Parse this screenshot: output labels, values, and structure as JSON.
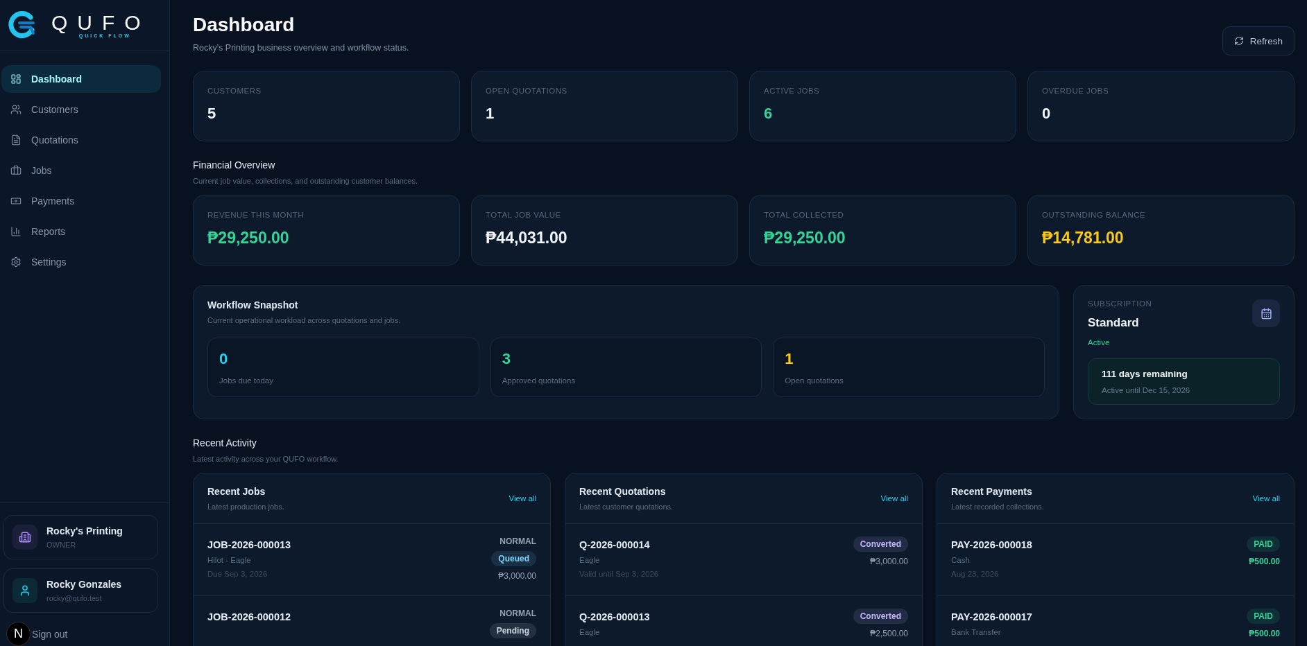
{
  "brand": {
    "name": "QUFO",
    "tagline": "QUICK FLOW"
  },
  "sidebar": {
    "items": [
      {
        "label": "Dashboard",
        "selected": true
      },
      {
        "label": "Customers",
        "selected": false
      },
      {
        "label": "Quotations",
        "selected": false
      },
      {
        "label": "Jobs",
        "selected": false
      },
      {
        "label": "Payments",
        "selected": false
      },
      {
        "label": "Reports",
        "selected": false
      },
      {
        "label": "Settings",
        "selected": false
      }
    ],
    "business": {
      "name": "Rocky's Printing",
      "role": "OWNER"
    },
    "user": {
      "name": "Rocky Gonzales",
      "email": "rocky@qufo.test"
    },
    "sign_out": "Sign out",
    "dev_indicator": "N"
  },
  "header": {
    "title": "Dashboard",
    "subtitle": "Rocky's Printing business overview and workflow status.",
    "refresh": "Refresh"
  },
  "stats": [
    {
      "label": "CUSTOMERS",
      "value": "5",
      "color": "#f1f5f9"
    },
    {
      "label": "OPEN QUOTATIONS",
      "value": "1",
      "color": "#f1f5f9"
    },
    {
      "label": "ACTIVE JOBS",
      "value": "6",
      "color": "#34d399"
    },
    {
      "label": "OVERDUE JOBS",
      "value": "0",
      "color": "#f1f5f9"
    }
  ],
  "financial": {
    "title": "Financial Overview",
    "subtitle": "Current job value, collections, and outstanding customer balances.",
    "cards": [
      {
        "label": "REVENUE THIS MONTH",
        "value": "₱29,250.00",
        "color": "#34d399"
      },
      {
        "label": "TOTAL JOB VALUE",
        "value": "₱44,031.00",
        "color": "#f1f5f9"
      },
      {
        "label": "TOTAL COLLECTED",
        "value": "₱29,250.00",
        "color": "#34d399"
      },
      {
        "label": "OUTSTANDING BALANCE",
        "value": "₱14,781.00",
        "color": "#facc15"
      }
    ]
  },
  "workflow": {
    "title": "Workflow Snapshot",
    "subtitle": "Current operational workload across quotations and jobs.",
    "items": [
      {
        "value": "0",
        "label": "Jobs due today",
        "color": "#22d3ee"
      },
      {
        "value": "3",
        "label": "Approved quotations",
        "color": "#34d399"
      },
      {
        "value": "1",
        "label": "Open quotations",
        "color": "#facc15"
      }
    ]
  },
  "subscription": {
    "label": "SUBSCRIPTION",
    "plan": "Standard",
    "status": "Active",
    "remaining": "111 days remaining",
    "until": "Active until Dec 15, 2026"
  },
  "recent": {
    "title": "Recent Activity",
    "subtitle": "Latest activity across your QUFO workflow.",
    "panels": [
      {
        "kind": "jobs",
        "title": "Recent Jobs",
        "subtitle": "Latest production jobs.",
        "link": "View all",
        "rows": [
          {
            "number": "JOB-2026-000013",
            "details": [
              "Hilot - Eagle",
              "Due Sep 3, 2026"
            ],
            "priority": "NORMAL",
            "status": {
              "label": "Queued",
              "color": "#7dd3fc"
            },
            "amount": "₱3,000.00"
          },
          {
            "number": "JOB-2026-000012",
            "details": [],
            "priority": "NORMAL",
            "status": {
              "label": "Pending",
              "color": "#cbd5e1"
            }
          }
        ]
      },
      {
        "kind": "quotations",
        "title": "Recent Quotations",
        "subtitle": "Latest customer quotations.",
        "link": "View all",
        "rows": [
          {
            "number": "Q-2026-000014",
            "details": [
              "Eagle",
              "Valid until Sep 3, 2026"
            ],
            "status": {
              "label": "Converted",
              "color": "#c4b5fd"
            },
            "amount": "₱3,000.00"
          },
          {
            "number": "Q-2026-000013",
            "details": [
              "Eagle"
            ],
            "status": {
              "label": "Converted",
              "color": "#c4b5fd"
            },
            "amount": "₱2,500.00"
          }
        ]
      },
      {
        "kind": "payments",
        "title": "Recent Payments",
        "subtitle": "Latest recorded collections.",
        "link": "View all",
        "rows": [
          {
            "number": "PAY-2026-000018",
            "details": [
              "Cash",
              "Aug 23, 2026"
            ],
            "status": {
              "label": "PAID",
              "color": "#34d399"
            },
            "amount": "₱500.00"
          },
          {
            "number": "PAY-2026-000017",
            "details": [
              "Bank Transfer"
            ],
            "status": {
              "label": "PAID",
              "color": "#34d399"
            },
            "amount": "₱500.00"
          }
        ]
      }
    ]
  }
}
